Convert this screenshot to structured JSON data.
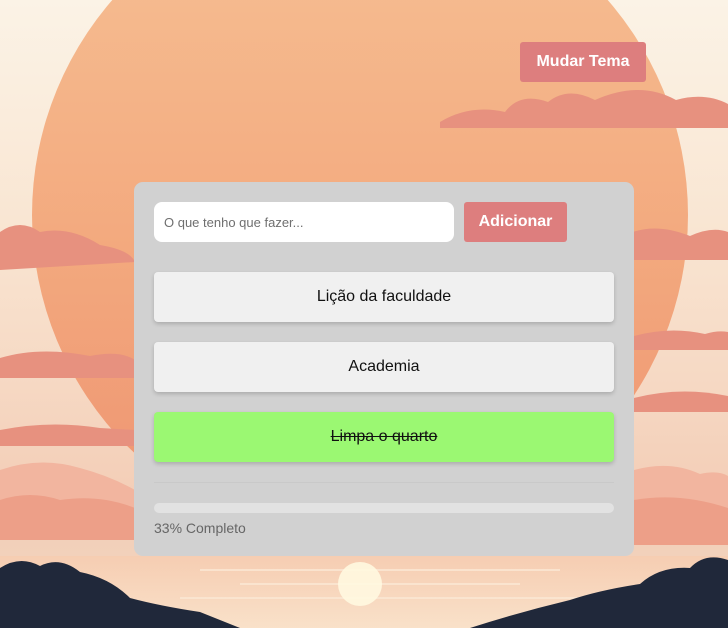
{
  "header": {
    "theme_button_label": "Mudar Tema"
  },
  "form": {
    "input_placeholder": "O que tenho que fazer...",
    "input_value": "",
    "add_button_label": "Adicionar"
  },
  "tasks": [
    {
      "label": "Lição da faculdade",
      "done": false
    },
    {
      "label": "Academia",
      "done": false
    },
    {
      "label": "Limpa o quarto",
      "done": true
    }
  ],
  "progress": {
    "fraction": 0.0,
    "label": "33% Completo"
  },
  "colors": {
    "accent": "#dd7e7e",
    "done": "#9bf872",
    "card": "#d1d1d1",
    "task": "#f0f0f0"
  }
}
